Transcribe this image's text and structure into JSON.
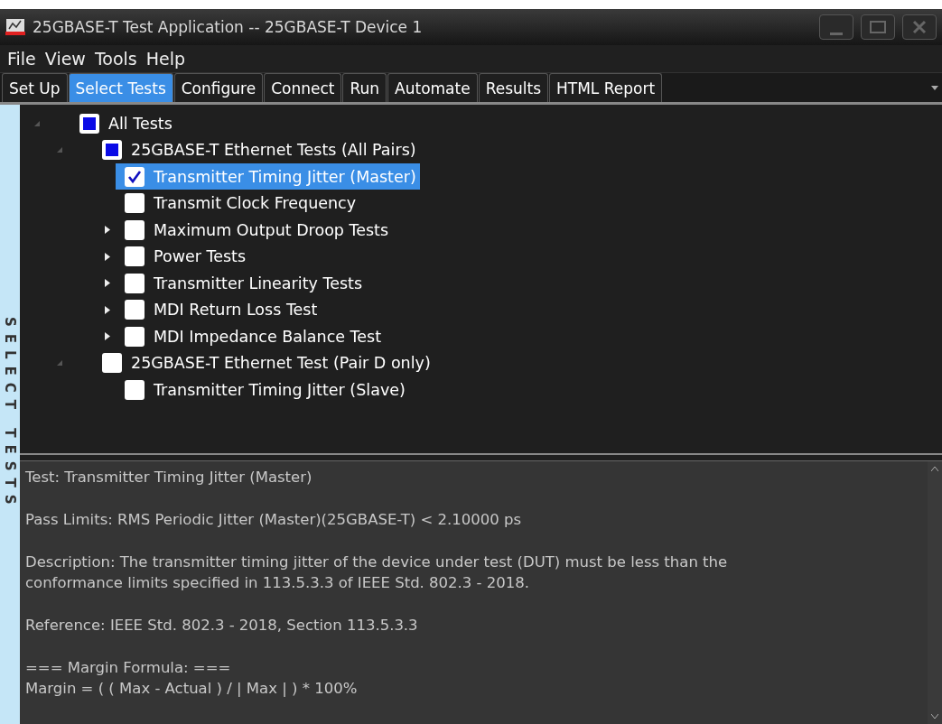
{
  "window": {
    "title": "25GBASE-T Test Application -- 25GBASE-T Device 1"
  },
  "menu": [
    "File",
    "View",
    "Tools",
    "Help"
  ],
  "tabs": [
    {
      "label": "Set Up",
      "selected": false
    },
    {
      "label": "Select Tests",
      "selected": true
    },
    {
      "label": "Configure",
      "selected": false
    },
    {
      "label": "Connect",
      "selected": false
    },
    {
      "label": "Run",
      "selected": false
    },
    {
      "label": "Automate",
      "selected": false
    },
    {
      "label": "Results",
      "selected": false
    },
    {
      "label": "HTML Report",
      "selected": false
    }
  ],
  "side_label": "SELECT TESTS",
  "tree": [
    {
      "label": "All Tests",
      "checked": false,
      "partial": true,
      "expanded": true,
      "selected": false,
      "children": [
        {
          "label": "25GBASE-T Ethernet Tests (All Pairs)",
          "checked": false,
          "partial": true,
          "expanded": true,
          "selected": false,
          "children": [
            {
              "label": "Transmitter Timing Jitter (Master)",
              "checked": true,
              "partial": false,
              "selected": true
            },
            {
              "label": "Transmit Clock Frequency",
              "checked": false,
              "partial": false,
              "selected": false
            },
            {
              "label": "Maximum Output Droop Tests",
              "checked": false,
              "partial": false,
              "expanded": false,
              "selected": false
            },
            {
              "label": "Power Tests",
              "checked": false,
              "partial": false,
              "expanded": false,
              "selected": false
            },
            {
              "label": "Transmitter Linearity Tests",
              "checked": false,
              "partial": false,
              "expanded": false,
              "selected": false
            },
            {
              "label": "MDI Return Loss Test",
              "checked": false,
              "partial": false,
              "expanded": false,
              "selected": false
            },
            {
              "label": "MDI Impedance Balance Test",
              "checked": false,
              "partial": false,
              "expanded": false,
              "selected": false
            }
          ]
        },
        {
          "label": "25GBASE-T Ethernet Test (Pair D only)",
          "checked": false,
          "partial": false,
          "expanded": true,
          "selected": false,
          "children": [
            {
              "label": "Transmitter Timing Jitter (Slave)",
              "checked": false,
              "partial": false,
              "selected": false
            }
          ]
        }
      ]
    }
  ],
  "details": [
    [
      "Test: Transmitter Timing Jitter (Master)"
    ],
    [
      "Pass Limits: RMS Periodic Jitter (Master)(25GBASE-T) < 2.10000 ps"
    ],
    [
      "Description: The transmitter timing jitter of the device under test (DUT) must be less than the",
      "conformance limits specified in 113.5.3.3 of IEEE Std. 802.3 - 2018."
    ],
    [
      "Reference: IEEE Std. 802.3 - 2018, Section 113.5.3.3"
    ],
    [
      "=== Margin Formula: ===",
      "Margin = ( ( Max - Actual ) / | Max | ) * 100%"
    ]
  ]
}
